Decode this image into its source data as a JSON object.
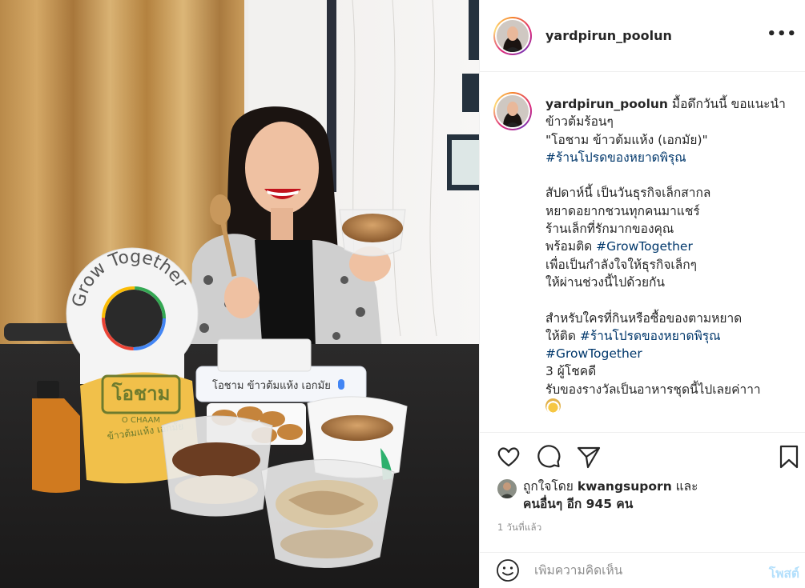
{
  "post": {
    "username": "yardpirun_poolun",
    "more_label": "•••"
  },
  "photo": {
    "sign_text": "Grow Together",
    "bag_brand": "โอชาม",
    "bag_brand_en": "O CHAAM",
    "bag_tagline": "ข้าวต้มแห้ง เอกมัย",
    "search_text": "โอชาม ข้าวต้มแห้ง เอกมัย"
  },
  "caption": {
    "username": "yardpirun_poolun",
    "line1": " มื้อดึกวันนี้ ขอแนะนำ",
    "line2": "ข้าวต้มร้อนๆ",
    "line3": "\"โอชาม ข้าวต้มแห้ง (เอกมัย)\"",
    "line4_tag": "#ร้านโปรดของหยาดพิรุณ",
    "line5": "สัปดาห์นี้ เป็นวันธุรกิจเล็กสากล",
    "line6": "หยาดอยากชวนทุกคนมาแชร์",
    "line7": "ร้านเล็กที่รักมากของคุณ",
    "line8_pre": "พร้อมติด ",
    "line8_tag": "#GrowTogether",
    "line9": "เพื่อเป็นกำลังใจให้ธุรกิจเล็กๆ",
    "line10": "ให้ผ่านช่วงนี้ไปด้วยกัน",
    "line11": "สำหรับใครที่กินหรือซื้อของตามหยาด",
    "line12_pre": "ให้ติด ",
    "line12_tag": "#ร้านโปรดของหยาดพิรุณ",
    "line13_tag": "#GrowTogether",
    "line14": "3 ผู้โชคดี",
    "line15": "รับของรางวัลเป็นอาหารชุดนี้ไปเลยค่าาา"
  },
  "likes": {
    "prefix": "ถูกใจโดย ",
    "liker": "kwangsuporn",
    "and": " และ",
    "others": "คนอื่นๆ อีก 945 คน"
  },
  "timestamp": "1 วันที่แล้ว",
  "comment": {
    "placeholder": "เพิ่มความคิดเห็น",
    "post_label": "โพสต์"
  },
  "colors": {
    "link": "#00376b",
    "post_disabled": "#b2dffc",
    "muted": "#8e8e8e",
    "border": "#efefef"
  },
  "icons": [
    "heart-icon",
    "comment-icon",
    "share-icon",
    "bookmark-icon",
    "smile-icon",
    "more-icon"
  ]
}
